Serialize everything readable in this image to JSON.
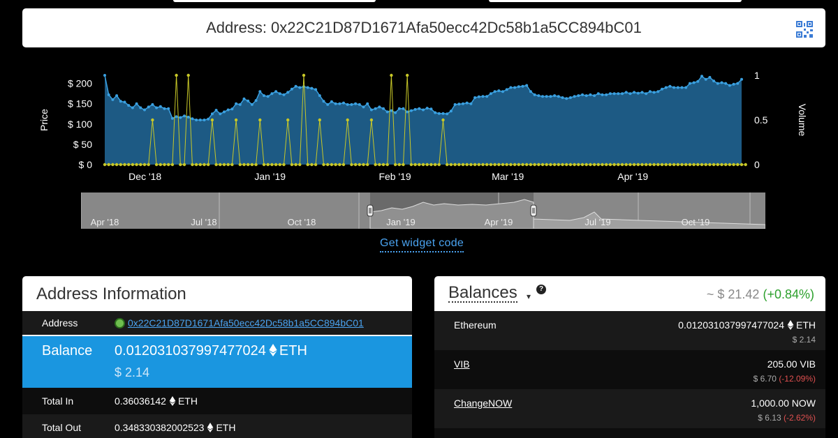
{
  "address_bar": {
    "label": "Address: 0x22C21D87D1671Afa50ecc42Dc58b1a5CC894bC01",
    "qr_icon": "qr-code-icon"
  },
  "chart_data": {
    "type": "area",
    "ylabel": "Price",
    "y2label": "Volume",
    "yticks": [
      "$ 200",
      "$ 150",
      "$ 100",
      "$ 50",
      "$ 0"
    ],
    "ylim": [
      0,
      220
    ],
    "y2ticks": [
      "1",
      "0.5",
      "0"
    ],
    "y2lim": [
      0,
      1
    ],
    "xticks": [
      "Dec '18",
      "Jan '19",
      "Feb '19",
      "Mar '19",
      "Apr '19"
    ],
    "x_range": [
      "2018-11-21",
      "2019-04-28"
    ],
    "series": [
      {
        "type": "area",
        "color": "#2e86c1",
        "values": [
          220,
          172,
          160,
          170,
          156,
          154,
          146,
          140,
          150,
          140,
          135,
          142,
          148,
          140,
          143,
          138,
          138,
          114,
          118,
          116,
          120,
          117,
          113,
          110,
          110,
          110,
          112,
          125,
          134,
          125,
          130,
          135,
          137,
          150,
          148,
          162,
          157,
          148,
          158,
          180,
          170,
          168,
          175,
          180,
          175,
          172,
          178,
          186,
          193,
          190,
          192,
          190,
          188,
          185,
          170,
          156,
          148,
          155,
          150,
          150,
          152,
          148,
          148,
          150,
          148,
          142,
          150,
          135,
          138,
          142,
          138,
          130,
          133,
          128,
          138,
          138,
          130,
          133,
          136,
          138,
          135,
          139,
          137,
          128,
          126,
          126,
          125,
          132,
          148,
          149,
          150,
          152,
          150,
          165,
          167,
          168,
          168,
          175,
          180,
          182,
          180,
          185,
          190,
          190,
          192,
          193,
          195,
          180,
          172,
          170,
          168,
          168,
          168,
          170,
          168,
          165,
          163,
          165,
          168,
          170,
          172,
          170,
          172,
          170,
          175,
          172,
          172,
          175,
          175,
          175,
          175,
          178,
          175,
          178,
          176,
          178,
          175,
          180,
          178,
          180,
          186,
          190,
          193,
          190,
          190,
          190,
          190,
          200,
          202,
          205,
          218,
          210,
          215,
          206,
          200,
          202,
          200,
          195,
          198,
          200,
          210
        ]
      },
      {
        "type": "line",
        "color": "#c8c828",
        "name": "Volume",
        "values": [
          0,
          0,
          0,
          0,
          0,
          0,
          0,
          0,
          0,
          0,
          0,
          0,
          0.5,
          0,
          0,
          0,
          0,
          0,
          1,
          0,
          0,
          1,
          0,
          0,
          0,
          0,
          0,
          0.5,
          0,
          0,
          0,
          0,
          0,
          0.5,
          0,
          0,
          0,
          0,
          0,
          0.5,
          0,
          0,
          0,
          0,
          0,
          0,
          0.5,
          0,
          0,
          0,
          1,
          0,
          0,
          0,
          0.5,
          0,
          0,
          0,
          0,
          0,
          0,
          0.5,
          0,
          0,
          0,
          0,
          0,
          0.5,
          0,
          0,
          0,
          0,
          1,
          0,
          0,
          0,
          1,
          0,
          0,
          0,
          0,
          0,
          0,
          0,
          0,
          0.5,
          0,
          0,
          0,
          0,
          0,
          0,
          0,
          0,
          0,
          0,
          0,
          0,
          0,
          0,
          0,
          0,
          0,
          0,
          0,
          0,
          0,
          0,
          0,
          0,
          0,
          0,
          0,
          0,
          0,
          0,
          0,
          0,
          0,
          0,
          0,
          0,
          0,
          0,
          0,
          0,
          0,
          0,
          0,
          0,
          0,
          0,
          0,
          0,
          0,
          0,
          0,
          0,
          0,
          0,
          0,
          0,
          0,
          0,
          0,
          0,
          0,
          0,
          0,
          0,
          0,
          0,
          0,
          0,
          0,
          0,
          0,
          0,
          0,
          0,
          0,
          0
        ]
      }
    ]
  },
  "navigator": {
    "ticks": [
      "Apr '18",
      "Jul '18",
      "Oct '18",
      "Jan '19",
      "Apr '19",
      "Jul '19",
      "Oct '19"
    ]
  },
  "widget_link": "Get widget code",
  "address_info": {
    "title": "Address Information",
    "address_label": "Address",
    "address_value": "0x22C21D87D1671Afa50ecc42Dc58b1a5CC894bC01",
    "balance_label": "Balance",
    "balance_value": "0.012031037997477024",
    "balance_unit": "ETH",
    "balance_usd": "$ 2.14",
    "total_in_label": "Total In",
    "total_in_value": "0.36036142",
    "total_in_unit": "ETH",
    "total_out_label": "Total Out",
    "total_out_value": "0.348330382002523",
    "total_out_unit": "ETH"
  },
  "balances": {
    "title": "Balances",
    "caret": "▾",
    "help": "?",
    "total": "~ $ 21.42",
    "total_change": "(+0.84%)",
    "tokens": [
      {
        "name": "Ethereum",
        "amount": "0.012031037997477024",
        "unit": "ETH",
        "usd": "$ 2.14",
        "change": ""
      },
      {
        "name": "VIB",
        "amount": "205.00 VIB",
        "unit": "",
        "usd": "$ 6.70",
        "change": "(-12.09%)"
      },
      {
        "name": "ChangeNOW",
        "amount": "1,000.00 NOW",
        "unit": "",
        "usd": "$ 6.13",
        "change": "(-2.62%)"
      }
    ]
  },
  "colors": {
    "accent": "#1a96e0",
    "link": "#4aa3f0",
    "positive": "#2ca02c",
    "negative": "#e05050"
  }
}
